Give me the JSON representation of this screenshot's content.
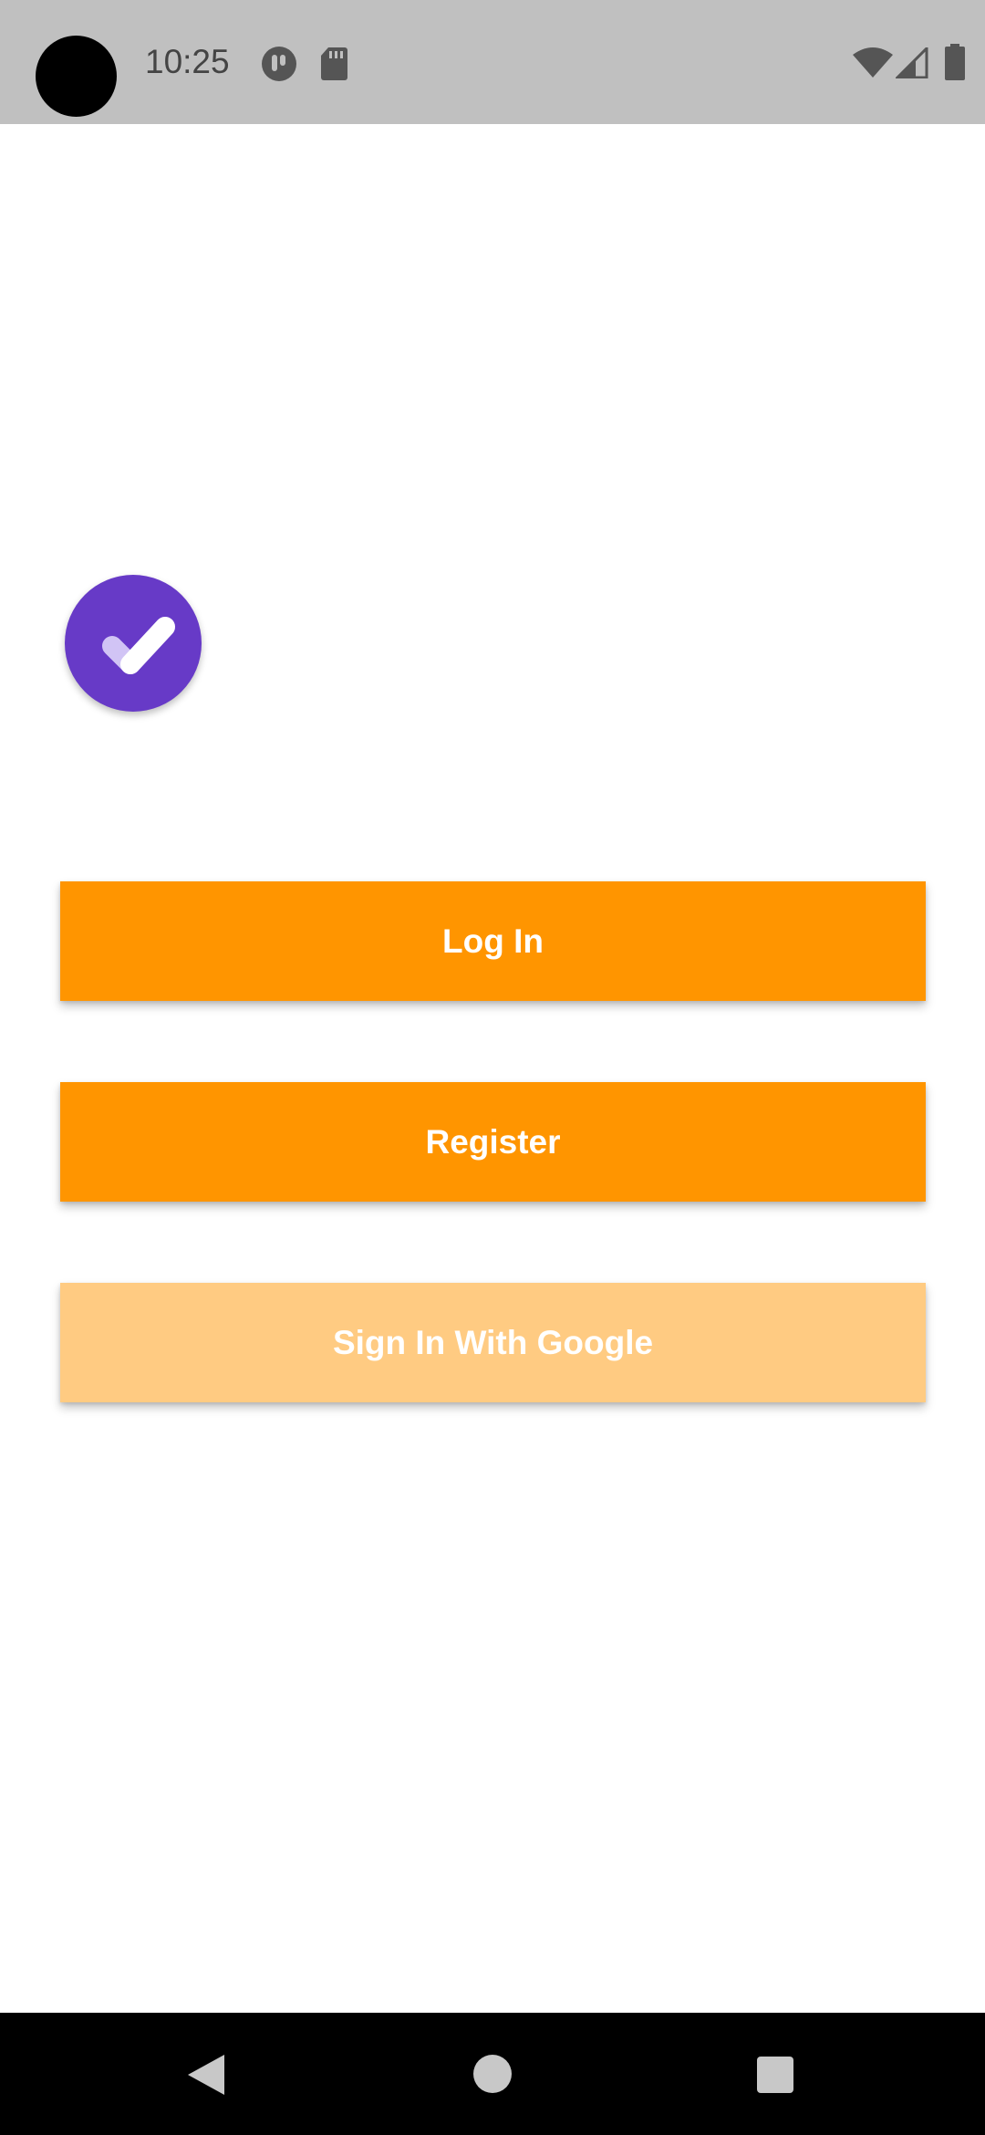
{
  "status_bar": {
    "time": "10:25",
    "icons": [
      "camera-cutout",
      "assistant-icon",
      "sd-card-icon",
      "wifi-icon",
      "cell-signal-icon",
      "battery-icon"
    ]
  },
  "logo": {
    "icon": "checkmark-icon",
    "background_color": "#673ac7",
    "check_color": "#ffffff",
    "check_shadow_color": "#d1c4f5"
  },
  "buttons": {
    "login_label": "Log In",
    "register_label": "Register",
    "google_label": "Sign In With Google"
  },
  "colors": {
    "primary_button": "#ff9500",
    "google_button": "#ffcb82",
    "status_bar": "#c0c0c0",
    "nav_bar": "#000000"
  },
  "nav_bar": {
    "icons": [
      "back-icon",
      "home-icon",
      "recents-icon"
    ]
  }
}
